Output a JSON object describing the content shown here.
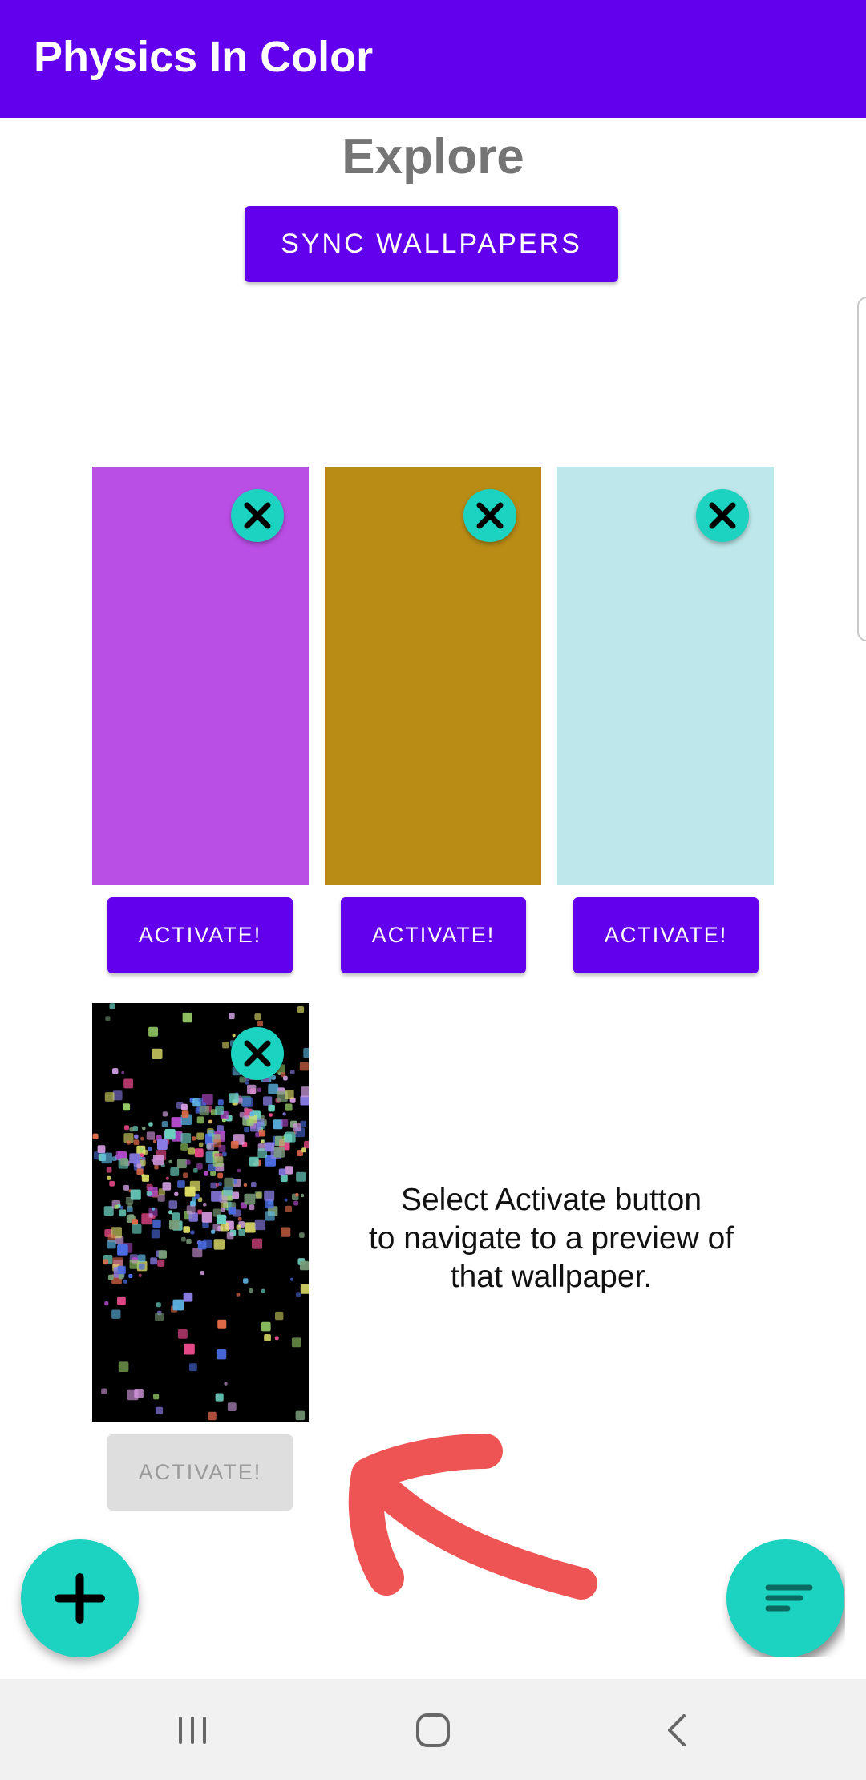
{
  "app_bar": {
    "title": "Physics In Color",
    "color": "#6200EE"
  },
  "main": {
    "title": "Explore",
    "sync_button_label": "SYNC WALLPAPERS",
    "hint_text": "Select Activate button\nto navigate to a preview of\nthat wallpaper."
  },
  "wallpapers": [
    {
      "preview_color": "#BA4FE5",
      "activate_label": "ACTIVATE!",
      "remove_icon": "close-icon",
      "activate_enabled": true
    },
    {
      "preview_color": "#B98C15",
      "activate_label": "ACTIVATE!",
      "remove_icon": "close-icon",
      "activate_enabled": true
    },
    {
      "preview_color": "#BDE7EA",
      "activate_label": "ACTIVATE!",
      "remove_icon": "close-icon",
      "activate_enabled": true
    },
    {
      "preview_color": "#000000",
      "preview_type": "colorful-particles",
      "activate_label": "ACTIVATE!",
      "remove_icon": "close-icon",
      "activate_enabled": false
    }
  ],
  "fabs": {
    "add_icon": "plus-icon",
    "filter_icon": "sort-filter-icon",
    "color": "#1BD3C0"
  },
  "annotation": {
    "arrow_color": "#EE5454"
  },
  "system_nav": {
    "recents_icon": "recents-icon",
    "home_icon": "home-icon",
    "back_icon": "back-icon"
  }
}
